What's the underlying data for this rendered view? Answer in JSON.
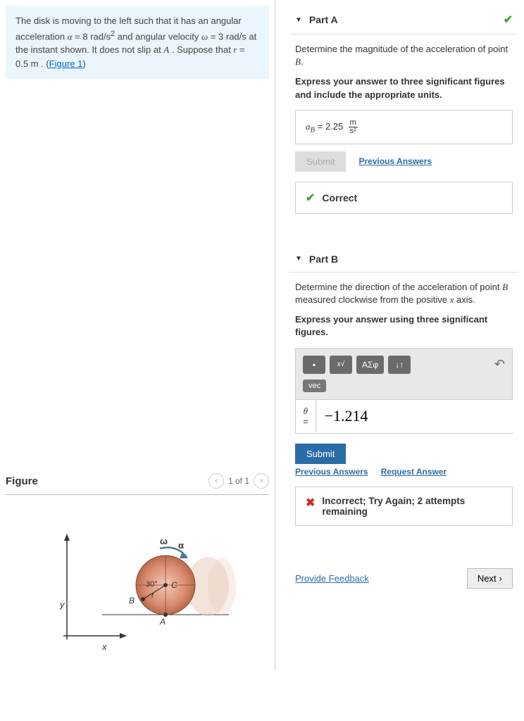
{
  "problem": {
    "text_before_alpha": "The disk is moving to the left such that it has an angular acceleration ",
    "alpha_eq": "α = 8 rad/s²",
    "text_mid1": " and angular velocity ",
    "omega_eq": "ω = 3 rad/s",
    "text_mid2": " at the instant shown. It does not slip at ",
    "point_a": "A",
    "text_mid3": ". Suppose that ",
    "r_eq": "r = 0.5 m",
    "text_end": " . (",
    "figure_link": "Figure 1",
    "close": ")"
  },
  "figure": {
    "title": "Figure",
    "pager": "1 of 1",
    "angle_label": "30°",
    "omega_sym": "ω",
    "alpha_sym": "α",
    "r_sym": "r",
    "C": "C",
    "B": "B",
    "A": "A",
    "x": "x",
    "y": "y"
  },
  "partA": {
    "title": "Part A",
    "question": "Determine the magnitude of the acceleration of point B.",
    "instruction": "Express your answer to three significant figures and include the appropriate units.",
    "var_label": "aB",
    "equals": " = ",
    "value": "2.25",
    "unit_num": "m",
    "unit_den": "s²",
    "submit": "Submit",
    "prev_answers": "Previous Answers",
    "feedback": "Correct"
  },
  "partB": {
    "title": "Part B",
    "question": "Determine the direction of the acceleration of point B measured clockwise from the positive x axis.",
    "instruction": "Express your answer using three significant figures.",
    "vec_label": "vec",
    "theta": "θ",
    "equals": "=",
    "input_value": "−1.214",
    "submit": "Submit",
    "prev_answers": "Previous Answers",
    "request_answer": "Request Answer",
    "feedback": "Incorrect; Try Again; 2 attempts remaining"
  },
  "footer": {
    "provide_feedback": "Provide Feedback",
    "next": "Next"
  },
  "toolbar": {
    "greek": "ΑΣφ",
    "arrows": "↓↑"
  }
}
